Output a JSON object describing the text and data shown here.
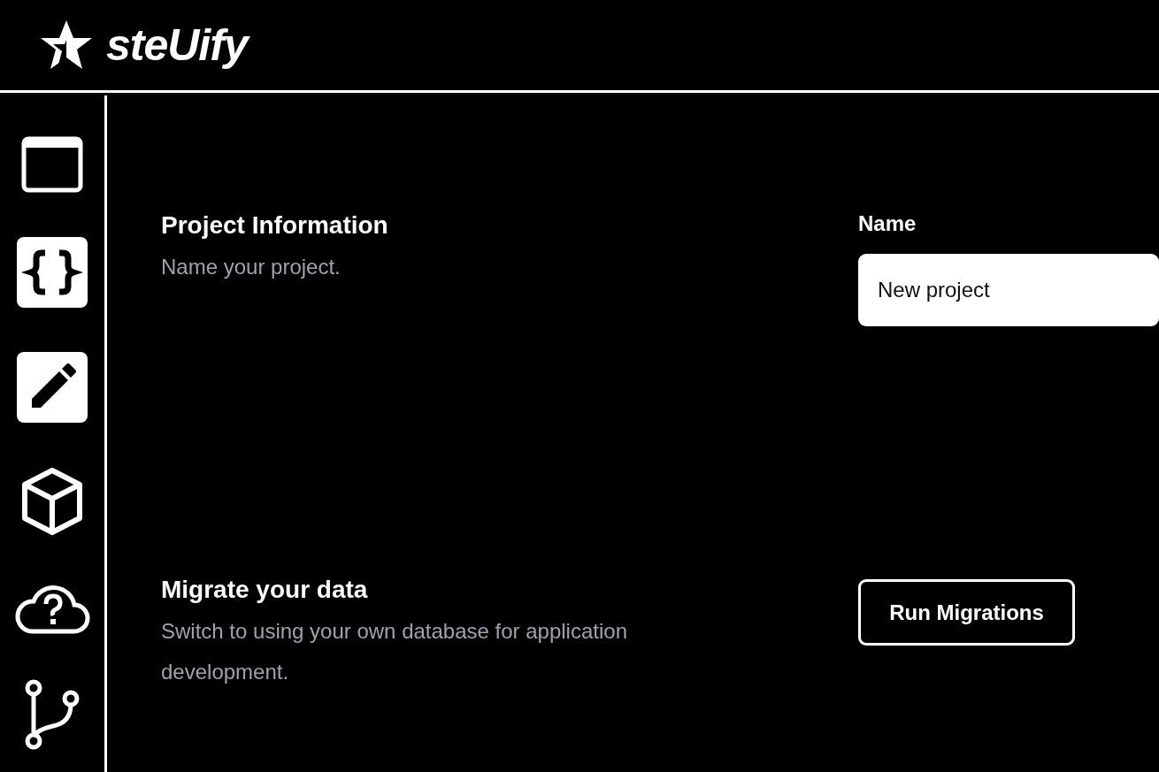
{
  "header": {
    "logo_text": "steUify"
  },
  "sections": [
    {
      "kind": "field",
      "title": "Project Information",
      "description": "Name your project.",
      "field_label": "Name",
      "value": "New project"
    },
    {
      "kind": "button",
      "title": "Migrate your data",
      "description": "Switch to using your own database for application development.",
      "button_label": "Run Migrations"
    }
  ]
}
